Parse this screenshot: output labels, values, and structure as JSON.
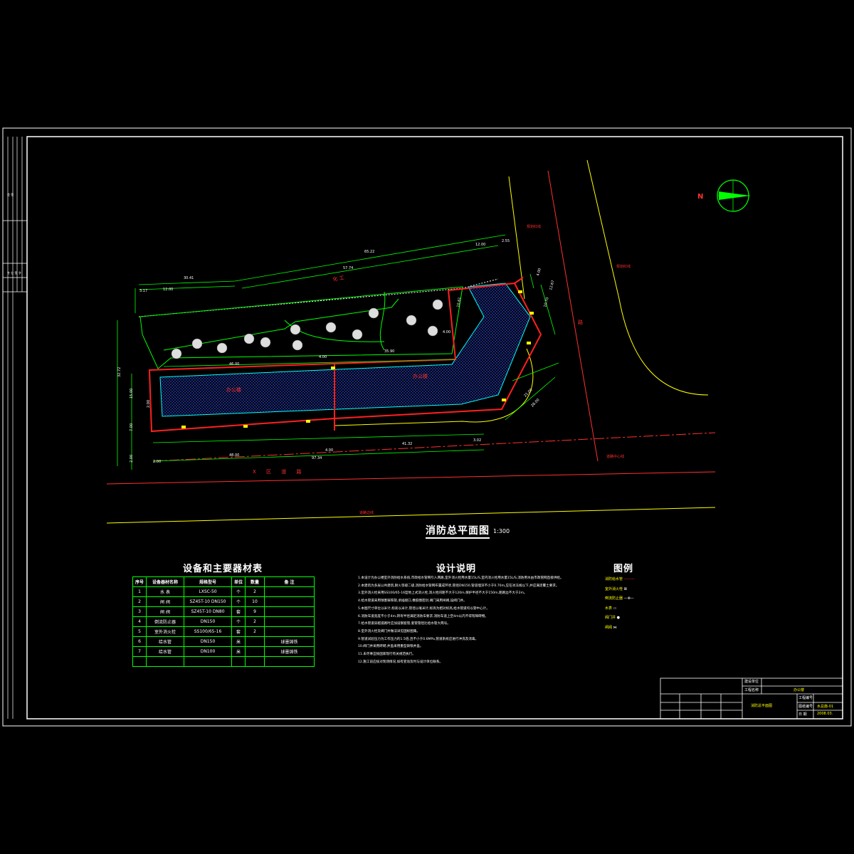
{
  "drawing": {
    "title": "消防总平面图",
    "scale": "1:300",
    "north_label": "N",
    "icons": [
      "north-arrow-icon"
    ],
    "colors": {
      "background": "#000000",
      "frame": "#ffffff",
      "fire_line": "#ff0000",
      "dimension": "#00ff00",
      "road": "#ffff00",
      "building": "#0000ff"
    }
  },
  "plan": {
    "dimensions": [
      "30.41",
      "12.00",
      "57.74",
      "65.22",
      "12.00",
      "2.55",
      "3.17",
      "4.00",
      "35.90",
      "46.00",
      "4.00",
      "41.32",
      "2.00",
      "48.00",
      "97.34",
      "32.72",
      "10.61",
      "4.00",
      "15.00",
      "2.00",
      "7.00",
      "21.00",
      "28.00",
      "10.70",
      "4.00",
      "3.02",
      "12.67",
      "2.00"
    ],
    "labels": {
      "factory": "化 工",
      "office_left": "办公楼",
      "office_right": "办公楼",
      "road_name": "X 区 道 路",
      "road_centerline": "道路中心线",
      "road_edge": "道路边线",
      "road_right": "路",
      "red_line_1": "规划红线",
      "red_line_2": "规划红线"
    }
  },
  "equipment_table": {
    "title": "设备和主要器材表",
    "headers": [
      "序号",
      "设备器材名称",
      "规格型号",
      "单位",
      "数量",
      "备 注"
    ],
    "rows": [
      [
        "1",
        "水 表",
        "LXSC-50",
        "个",
        "2",
        ""
      ],
      [
        "2",
        "闸 阀",
        "SZ45T-10 DN150",
        "个",
        "10",
        ""
      ],
      [
        "3",
        "闸 阀",
        "SZ45T-10 DN80",
        "套",
        "9",
        ""
      ],
      [
        "4",
        "倒流防止器",
        "DN150",
        "个",
        "2",
        ""
      ],
      [
        "5",
        "室外消火栓",
        "SS100/65-16",
        "套",
        "2",
        ""
      ],
      [
        "6",
        "给水管",
        "DN150",
        "米",
        "",
        "球墨铸铁"
      ],
      [
        "7",
        "给水管",
        "DN100",
        "米",
        "",
        "球墨铸铁"
      ],
      [
        "",
        "",
        "",
        "",
        "",
        ""
      ]
    ]
  },
  "notes": {
    "title": "设计说明",
    "items": [
      "1.本设计为办公楼室外消防给水系统,市政给水管网引入两路,室外消火栓用水量15L/S,室内消火栓用水量15L/S,消防用水由市政管网直接供给。",
      "2.本建筑为多层公共建筑,耐火等级二级,消防给水管网布置成环状,管径DN150,管道埋深不小于0.70m,应在冰冻线以下,并应满足覆土要求。",
      "3.室外消火栓采用SS100/65-16型地上式消火栓,消火栓间距不大于120m,保护半径不大于150m,距路边不大于2m。",
      "4.给水管道采用球墨铸铁管,承插接口,橡胶圈密封,阀门采用闸阀,设阀门井。",
      "5.本图尺寸单位以米计,标高以米计,管径以毫米计,标高为相对标高,给水管道均以管中心计。",
      "6.消防车道宽度不小于4m,转弯半径满足消防车要求,消防车道上空4m以内不得有障碍物。",
      "7.给水管道穿越道路时应加设钢套管,套管管径比给水管大两号。",
      "8.室外消火栓及阀门井做法详见国标图集。",
      "9.管道试验压力为工作压力的1.5倍,且不小于0.6MPa,管道系统应进行冲洗及消毒。",
      "10.阀门井采用砖砌,井盖采用重型铸铁井盖。",
      "11.未尽事宜按国家现行有关规范执行。",
      "12.施工前应核对现场情况,如有变动及时与设计单位联系。"
    ]
  },
  "legend": {
    "title": "图例",
    "items": [
      {
        "name": "消防给水管",
        "symbol": "———"
      },
      {
        "name": "室外消火栓",
        "symbol": "⊠"
      },
      {
        "name": "倒流防止器",
        "symbol": "—⊗—"
      },
      {
        "name": "水表",
        "symbol": "▭"
      },
      {
        "name": "阀门井",
        "symbol": "●"
      },
      {
        "name": "闸阀",
        "symbol": "⋈"
      }
    ]
  },
  "title_block": {
    "client_label": "建设单位",
    "project_label": "工程名称",
    "project_value": "办公楼",
    "drawing_name": "消防总平面图",
    "project_no_label": "工程编号",
    "drawing_no_label": "图纸编号",
    "drawing_no_value": "水总施-01",
    "date_label": "日 期",
    "date_value": "2008.03."
  },
  "side_strip": {
    "upper": "会 签",
    "lower": "专 业 签 字"
  }
}
